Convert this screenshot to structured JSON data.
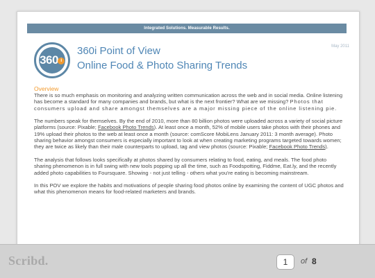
{
  "document": {
    "banner": "Integrated Solutions. Measurable Results.",
    "date": "May 2011",
    "logo_text": "360",
    "logo_dot": "i",
    "title_line1": "360i Point of View",
    "title_line2": "Online Food & Photo Sharing Trends",
    "section_heading": "Overview",
    "p1_text": "There is so much emphasis on monitoring and analyzing written communication across the web and in social media. Online listening has become a standard for many companies and brands, but what is the next frontier? What are we missing? ",
    "p1_emphasis": "Photos that consumers upload and share amongst themselves are a major missing piece of the online listening pie.",
    "p2_part1": "The numbers speak for themselves. By the end of 2010, more than 80 billion photos were uploaded across a variety of social picture platforms (source: Pixable; ",
    "p2_link1": "Facebook Photo Trends",
    "p2_part2": ").  At least once a month, 52% of mobile users take photos with their phones and 19% upload their photos to the web at least once a month (source: comScore MobiLens January 2011: 3 month average). Photo sharing behavior amongst consumers is especially important to look at when creating marketing programs targeted towards women; they are twice as likely than their male counterparts to upload, tag and view photos (source: Pixable; ",
    "p2_link2": "Facebook Photo Trends",
    "p2_part3": ").",
    "p3": "The analysis that follows looks specifically at photos shared by consumers relating to food, eating, and meals. The food photo sharing phenomenon is in full swing with new tools popping up all the time, such as Foodspotting, Fiddme, Eat.ly, and the recently added photo capabilities to Foursquare. Showing - not just telling - others what you're eating is becoming mainstream.",
    "p4": "In this POV we explore the habits and motivations of people sharing food photos online by examining the content of UGC photos and what this phenomenon means for food-related marketers and brands."
  },
  "toolbar": {
    "brand": "Scribd.",
    "current_page": "1",
    "of_label": "of",
    "total_pages": "8"
  }
}
